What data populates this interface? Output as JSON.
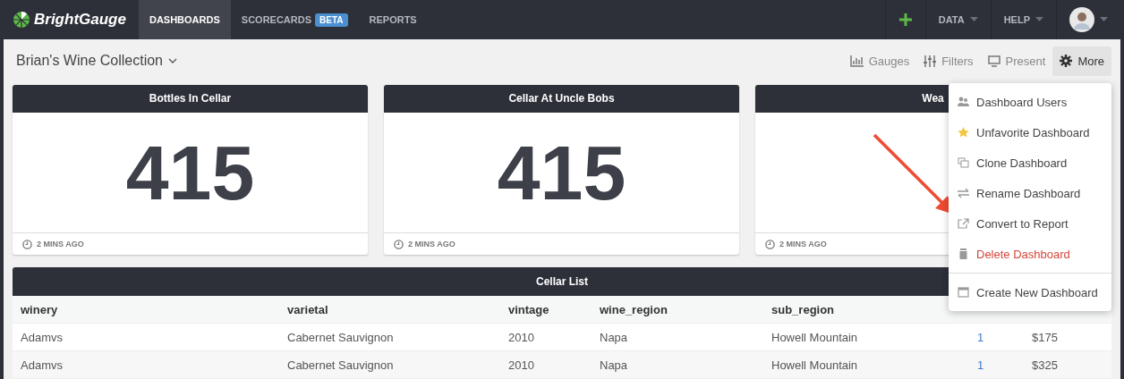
{
  "nav": {
    "brand": "BrightGauge",
    "items": [
      {
        "label": "DASHBOARDS",
        "selected": true
      },
      {
        "label": "SCORECARDS",
        "badge": "BETA",
        "selected": false
      },
      {
        "label": "REPORTS",
        "selected": false
      }
    ],
    "right": [
      {
        "kind": "add"
      },
      {
        "kind": "menu",
        "label": "DATA"
      },
      {
        "kind": "menu",
        "label": "HELP"
      },
      {
        "kind": "avatar"
      }
    ]
  },
  "toolbar": {
    "title": "Brian's Wine Collection",
    "actions": [
      {
        "kind": "gauges",
        "label": "Gauges",
        "selected": false
      },
      {
        "kind": "filters",
        "label": "Filters",
        "selected": false
      },
      {
        "kind": "present",
        "label": "Present",
        "selected": false
      },
      {
        "kind": "more",
        "label": "More",
        "selected": true
      }
    ]
  },
  "cards": [
    {
      "title": "Bottles In Cellar",
      "value": "415",
      "time": "2 MINS AGO"
    },
    {
      "title": "Cellar At Uncle Bobs",
      "value": "415",
      "time": "2 MINS AGO"
    },
    {
      "title": "Wea",
      "time": "2 MINS AGO"
    }
  ],
  "table": {
    "title": "Cellar List",
    "columns": [
      "winery",
      "varietal",
      "vintage",
      "wine_region",
      "sub_region"
    ],
    "rows": [
      [
        "Adamvs",
        "Cabernet Sauvignon",
        "2010",
        "Napa",
        "Howell Mountain",
        "1",
        "$175"
      ],
      [
        "Adamvs",
        "Cabernet Sauvignon",
        "2010",
        "Napa",
        "Howell Mountain",
        "1",
        "$325"
      ]
    ]
  },
  "menu": [
    {
      "kind": "users",
      "label": "Dashboard Users",
      "danger": false,
      "divider_before": false
    },
    {
      "kind": "star",
      "label": "Unfavorite Dashboard",
      "danger": false,
      "divider_before": false
    },
    {
      "kind": "clone",
      "label": "Clone Dashboard",
      "danger": false,
      "divider_before": false
    },
    {
      "kind": "swap",
      "label": "Rename Dashboard",
      "danger": false,
      "divider_before": false
    },
    {
      "kind": "external",
      "label": "Convert to Report",
      "danger": false,
      "divider_before": false
    },
    {
      "kind": "trash",
      "label": "Delete Dashboard",
      "danger": true,
      "divider_before": false
    },
    {
      "kind": "window",
      "label": "Create New Dashboard",
      "danger": false,
      "divider_before": true
    }
  ]
}
